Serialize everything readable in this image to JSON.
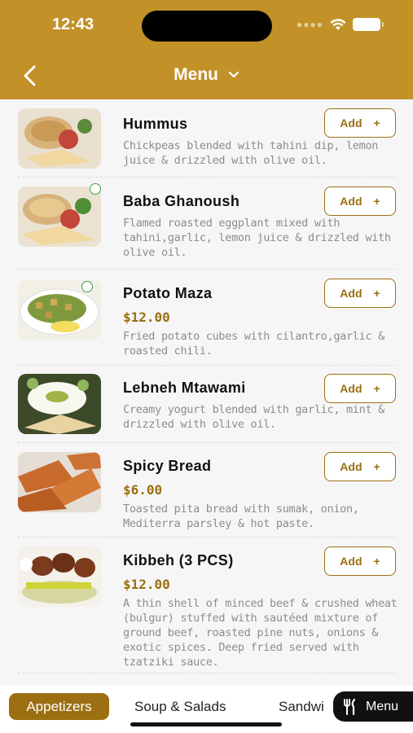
{
  "status_bar": {
    "time": "12:43"
  },
  "header": {
    "title": "Menu",
    "back_icon": "chevron-left-icon",
    "dropdown_icon": "chevron-down-icon"
  },
  "items": [
    {
      "name": "Hummus",
      "price": "",
      "description": "Chickpeas blended with tahini dip, lemon juice & drizzled with olive oil.",
      "add_label": "Add",
      "veg": false
    },
    {
      "name": "Baba Ghanoush",
      "price": "",
      "description": "Flamed roasted eggplant mixed with tahini,garlic, lemon juice & drizzled with olive oil.",
      "add_label": "Add",
      "veg": true
    },
    {
      "name": "Potato Maza",
      "price": "$12.00",
      "description": "Fried potato cubes with cilantro,garlic & roasted chili.",
      "add_label": "Add",
      "veg": true
    },
    {
      "name": "Lebneh Mtawami",
      "price": "",
      "description": "Creamy yogurt blended with garlic, mint & drizzled with olive oil.",
      "add_label": "Add",
      "veg": false
    },
    {
      "name": "Spicy Bread",
      "price": "$6.00",
      "description": "Toasted pita bread with sumak, onion, Mediterra parsley & hot paste.",
      "add_label": "Add",
      "veg": false
    },
    {
      "name": "Kibbeh (3 PCS)",
      "price": "$12.00",
      "description": "A thin shell of minced beef & crushed wheat (bulgur) stuffed with sautéed mixture of ground beef, roasted pine nuts, onions & exotic spices. Deep fried served with tzatziki sauce.",
      "add_label": "Add",
      "veg": false
    }
  ],
  "categories": [
    "Appetizers",
    "Soup & Salads",
    "Sandwi"
  ],
  "active_category": "Appetizers",
  "menu_button": {
    "label": "Menu",
    "icon": "utensils-icon"
  },
  "colors": {
    "header": "#c29128",
    "accent": "#9b6f12",
    "text": "#111111",
    "muted": "#8c8c8c"
  }
}
